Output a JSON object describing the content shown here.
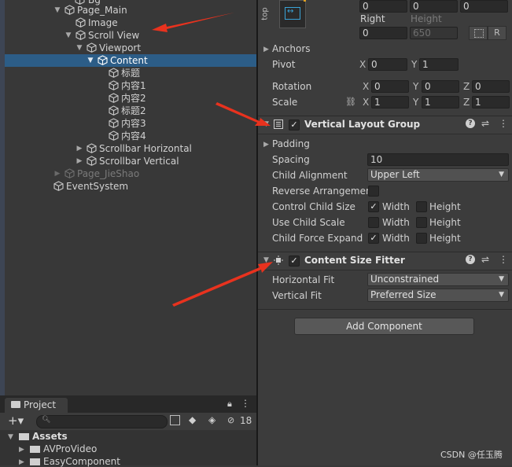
{
  "hierarchy": {
    "items": [
      {
        "label": "Bg",
        "depth": 0
      },
      {
        "label": "Page_Main",
        "depth": 0
      },
      {
        "label": "Image",
        "depth": 1
      },
      {
        "label": "Scroll View",
        "depth": 1
      },
      {
        "label": "Viewport",
        "depth": 2
      },
      {
        "label": "Content",
        "depth": 3
      },
      {
        "label": "标题",
        "depth": 4
      },
      {
        "label": "内容1",
        "depth": 4
      },
      {
        "label": "内容2",
        "depth": 4
      },
      {
        "label": "标题2",
        "depth": 4
      },
      {
        "label": "内容3",
        "depth": 4
      },
      {
        "label": "内容4",
        "depth": 4
      },
      {
        "label": "Scrollbar Horizontal",
        "depth": 2
      },
      {
        "label": "Scrollbar Vertical",
        "depth": 2
      },
      {
        "label": "Page_JieShao",
        "depth": 0
      },
      {
        "label": "EventSystem",
        "depth": 0
      }
    ]
  },
  "rect_transform": {
    "top_label": "top",
    "top_fields": [
      "0",
      "0",
      "0"
    ],
    "right_label": "Right",
    "height_label": "Height",
    "right_value": "0",
    "height_value": "650",
    "r_button": "R",
    "anchors_label": "Anchors",
    "pivot_label": "Pivot",
    "pivot_x": "0",
    "pivot_y": "1",
    "rotation_label": "Rotation",
    "rotation": [
      "0",
      "0",
      "0"
    ],
    "scale_label": "Scale",
    "scale": [
      "1",
      "1",
      "1"
    ],
    "axis_x": "X",
    "axis_y": "Y",
    "axis_z": "Z"
  },
  "vertical_layout_group": {
    "title": "Vertical Layout Group",
    "padding_label": "Padding",
    "spacing_label": "Spacing",
    "spacing_value": "10",
    "child_alignment_label": "Child Alignment",
    "child_alignment_value": "Upper Left",
    "reverse_label": "Reverse Arrangement",
    "control_child_size_label": "Control Child Size",
    "use_child_scale_label": "Use Child Scale",
    "child_force_expand_label": "Child Force Expand",
    "width_label": "Width",
    "height_label": "Height"
  },
  "content_size_fitter": {
    "title": "Content Size Fitter",
    "horizontal_fit_label": "Horizontal Fit",
    "horizontal_fit_value": "Unconstrained",
    "vertical_fit_label": "Vertical Fit",
    "vertical_fit_value": "Preferred Size"
  },
  "add_component_label": "Add Component",
  "project": {
    "tab_label": "Project",
    "badge_count": "18",
    "assets_label": "Assets",
    "folders": [
      "AVProVideo",
      "EasyComponent"
    ]
  },
  "watermark": "CSDN @任玉腾",
  "colors": {
    "selection": "#2c5d87",
    "arrow": "#e8321e"
  }
}
